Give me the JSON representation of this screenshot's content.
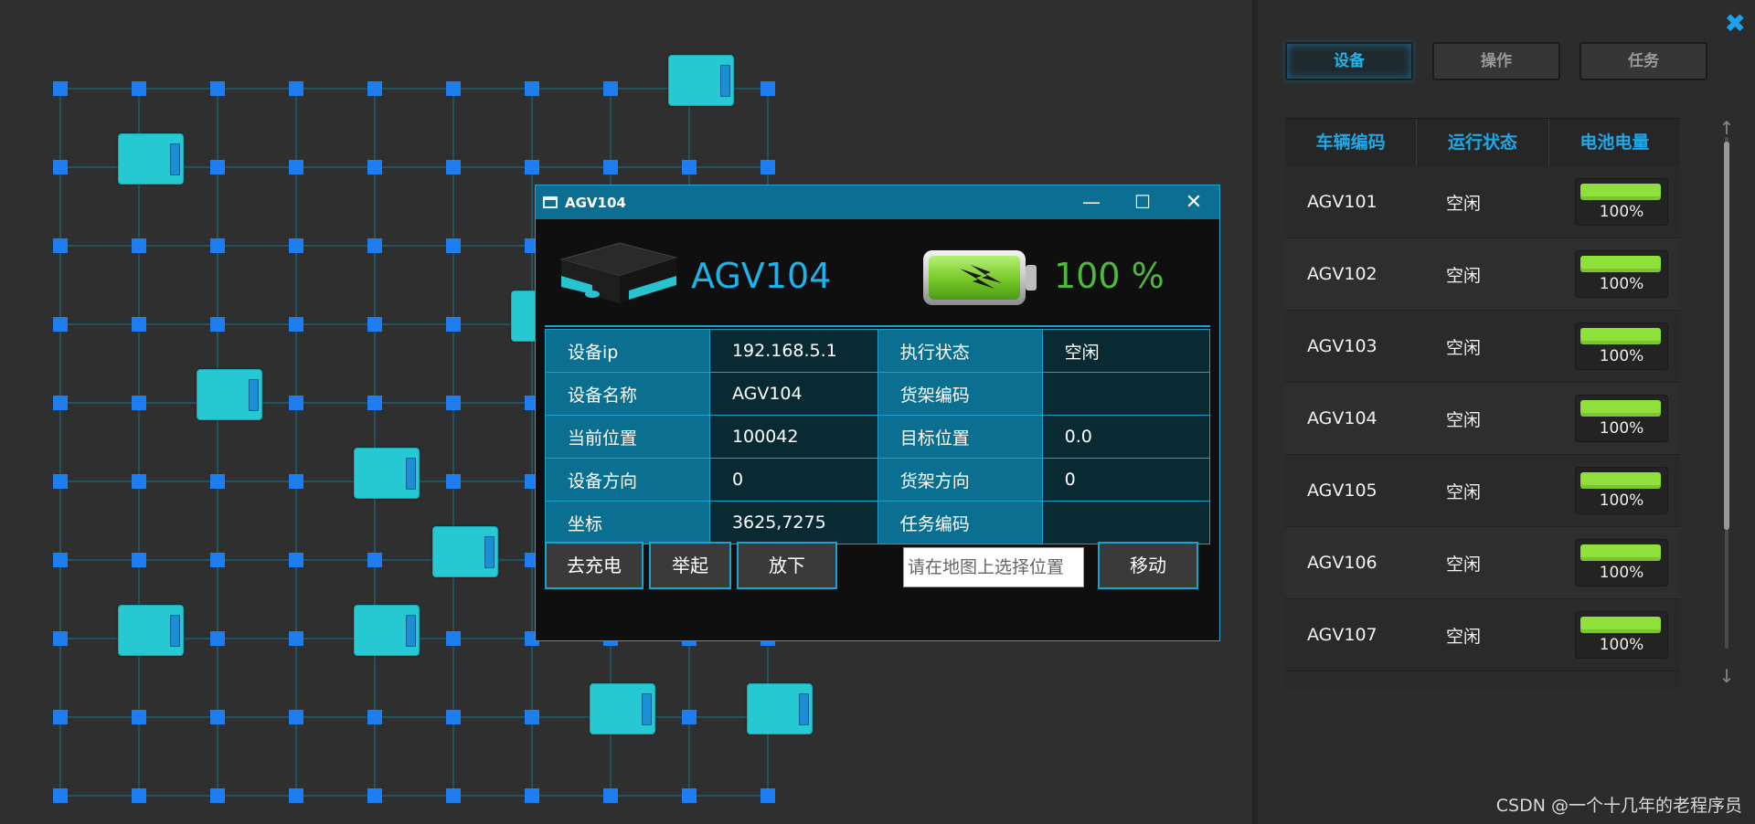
{
  "panel": {
    "tabs": [
      {
        "label": "设备",
        "active": true
      },
      {
        "label": "操作",
        "active": false
      },
      {
        "label": "任务",
        "active": false
      }
    ],
    "table": {
      "headers": [
        "车辆编码",
        "运行状态",
        "电池电量"
      ],
      "rows": [
        {
          "code": "AGV101",
          "status": "空闲",
          "battery": "100%",
          "level": 1.0
        },
        {
          "code": "AGV102",
          "status": "空闲",
          "battery": "100%",
          "level": 1.0
        },
        {
          "code": "AGV103",
          "status": "空闲",
          "battery": "100%",
          "level": 1.0
        },
        {
          "code": "AGV104",
          "status": "空闲",
          "battery": "100%",
          "level": 1.0
        },
        {
          "code": "AGV105",
          "status": "空闲",
          "battery": "100%",
          "level": 1.0
        },
        {
          "code": "AGV106",
          "status": "空闲",
          "battery": "100%",
          "level": 1.0
        },
        {
          "code": "AGV107",
          "status": "空闲",
          "battery": "100%",
          "level": 1.0
        }
      ]
    },
    "close_icon": "close-icon",
    "watermark": "CSDN @一个十几年的老程序员"
  },
  "dialog": {
    "title": "AGV104",
    "agv_name": "AGV104",
    "battery_text": "100 %",
    "info": [
      {
        "k1": "设备ip",
        "v1": "192.168.5.1",
        "k2": "执行状态",
        "v2": "空闲"
      },
      {
        "k1": "设备名称",
        "v1": "AGV104",
        "k2": "货架编码",
        "v2": ""
      },
      {
        "k1": "当前位置",
        "v1": "100042",
        "k2": "目标位置",
        "v2": "0.0"
      },
      {
        "k1": "设备方向",
        "v1": "0",
        "k2": "货架方向",
        "v2": "0"
      },
      {
        "k1": "坐标",
        "v1": "3625,7275",
        "k2": "任务编码",
        "v2": ""
      }
    ],
    "buttons": {
      "charge": "去充电",
      "lift": "举起",
      "drop": "放下",
      "move": "移动"
    },
    "location_input": {
      "placeholder": "请在地图上选择位置",
      "value": ""
    }
  },
  "colors": {
    "accent": "#1fa8e8",
    "node": "#1e7ef0",
    "grid_line": "#1d5f74",
    "agv": "#26c9d2",
    "battery_green": "#8fe03a"
  }
}
